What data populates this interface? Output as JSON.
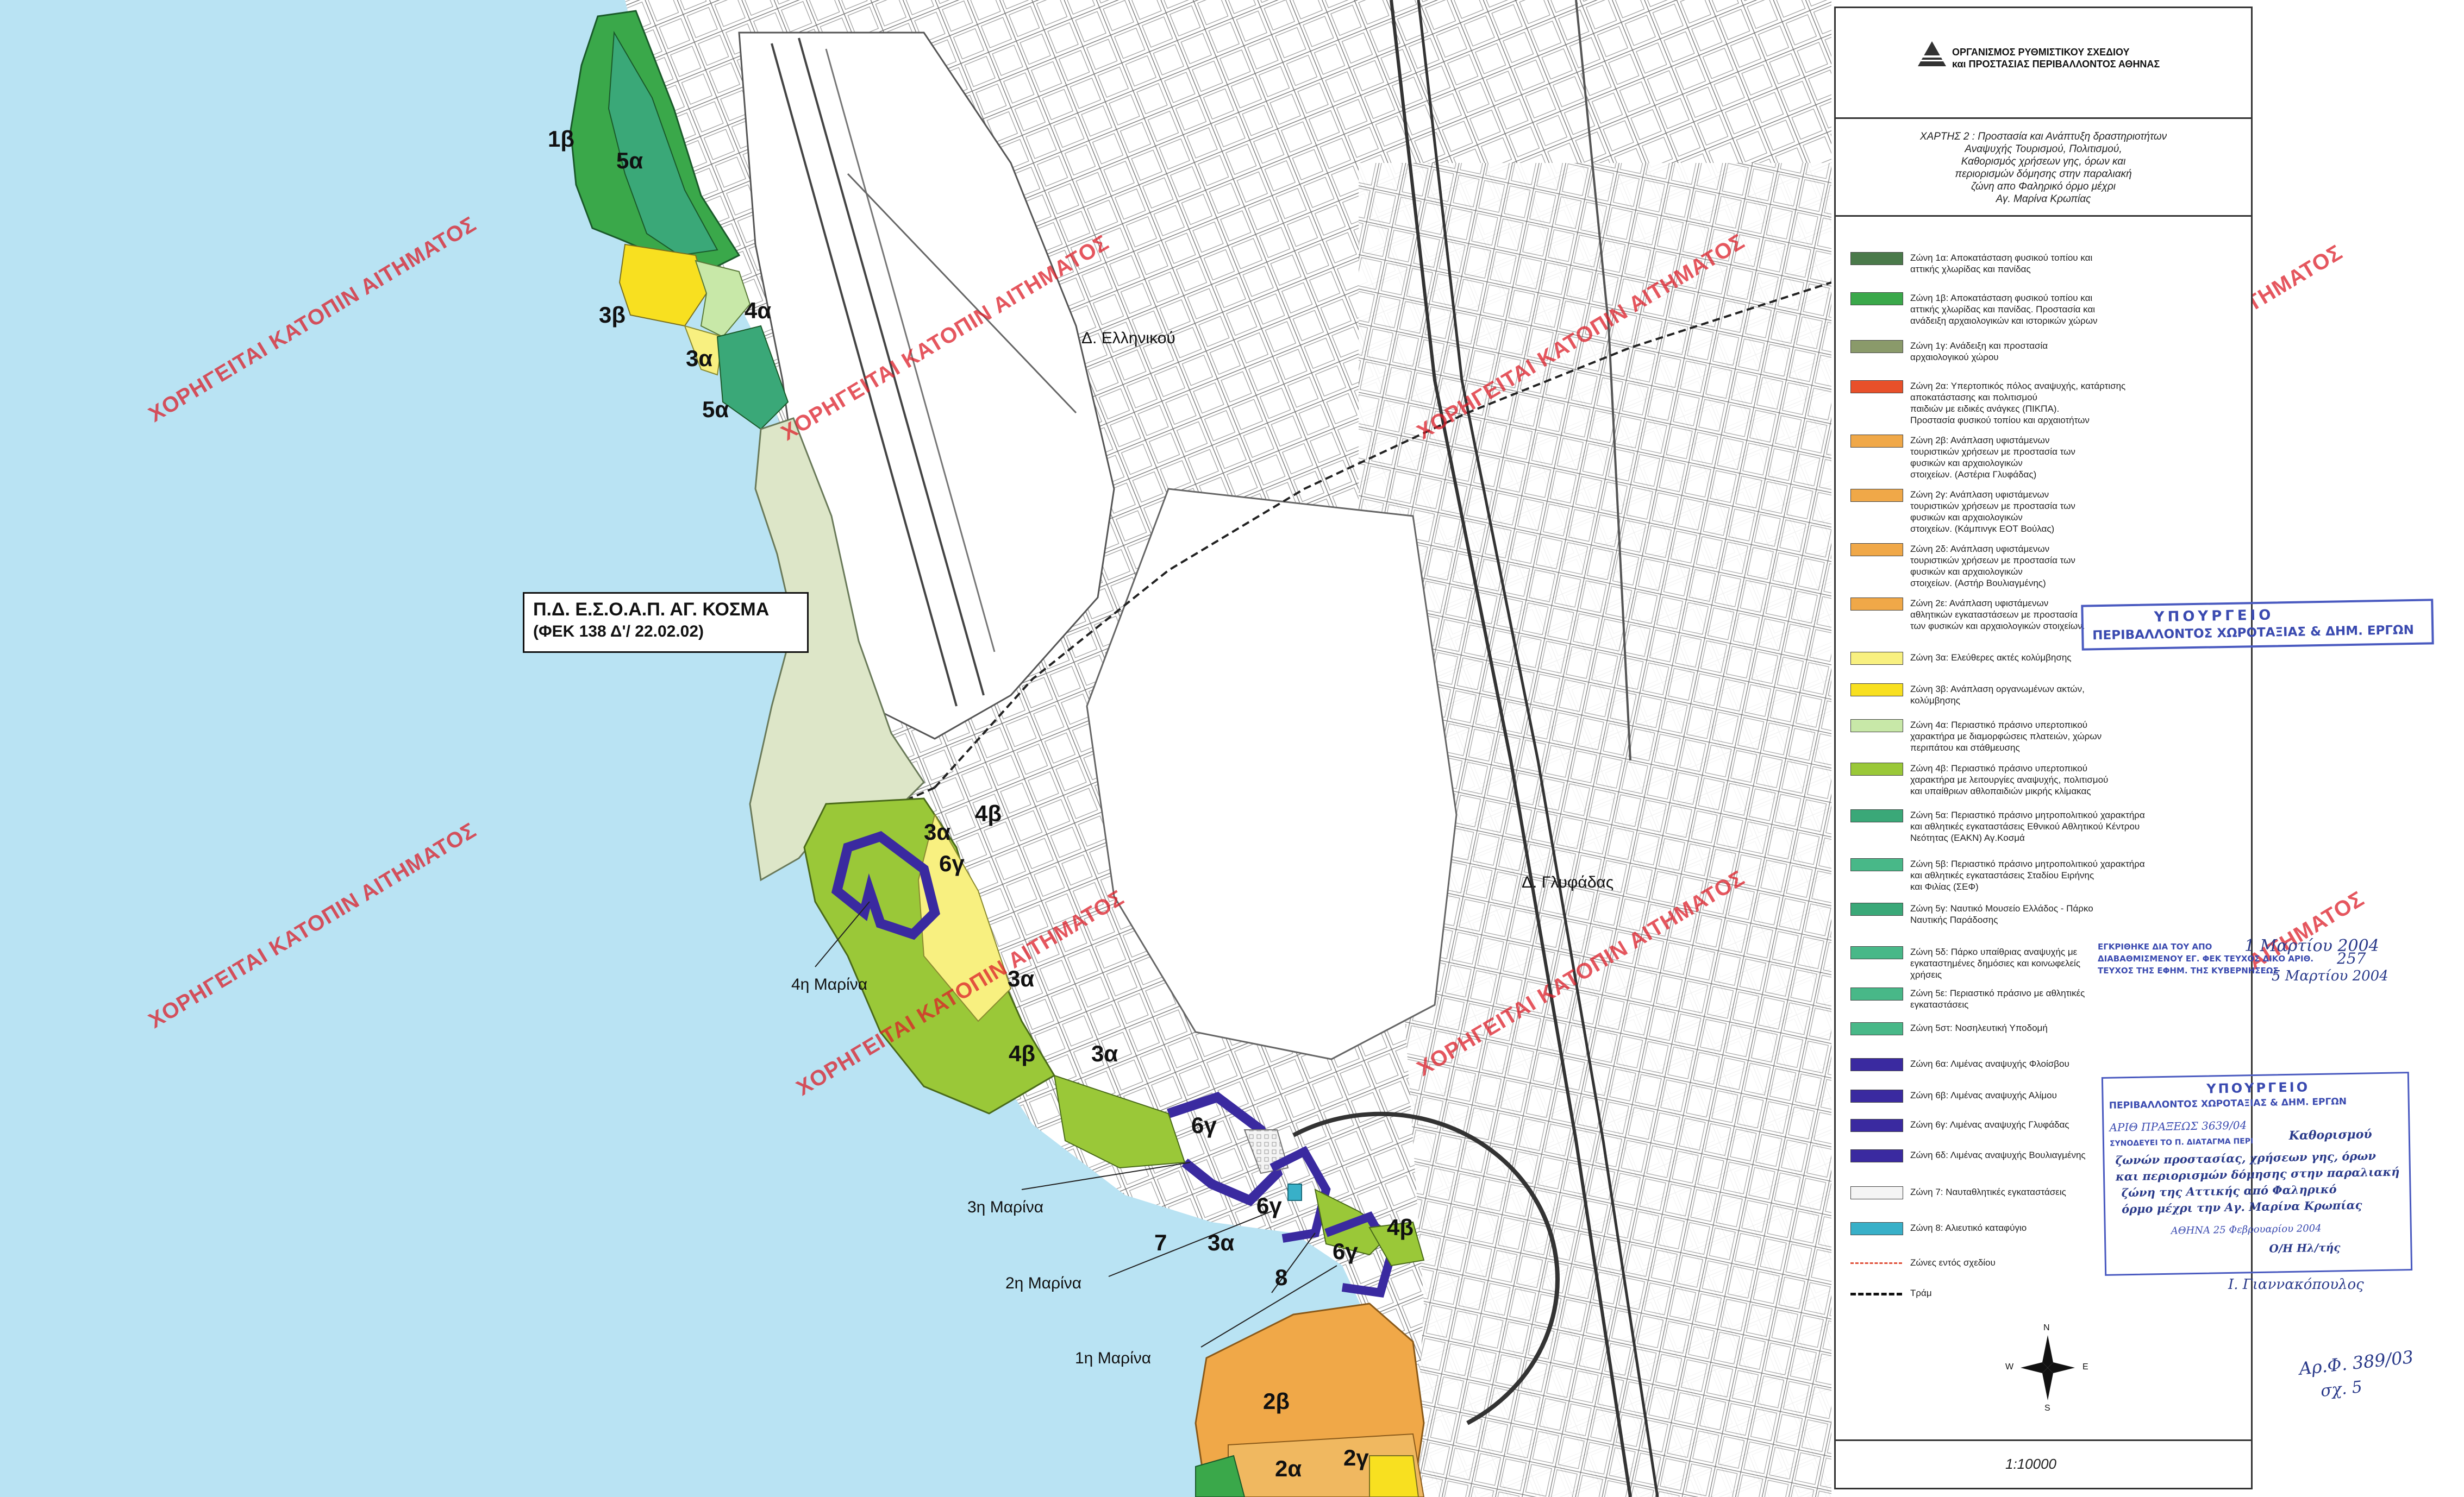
{
  "org": {
    "line1": "ΟΡΓΑΝΙΣΜΟΣ ΡΥΘΜΙΣΤΙΚΟΥ ΣΧΕΔΙΟΥ",
    "line2": "και ΠΡΟΣΤΑΣΙΑΣ ΠΕΡΙΒΑΛΛΟΝΤΟΣ ΑΘΗΝΑΣ"
  },
  "map_title": [
    "ΧΑΡΤΗΣ 2 : Προστασία και Ανάπτυξη δραστηριοτήτων",
    "Αναψυχής Τουρισμού, Πολιτισμού,",
    "Καθορισμός χρήσεων γης, όρων και",
    "περιορισμών δόμησης στην παραλιακή",
    "ζώνη απο Φαληρικό όρμο μέχρι",
    "Αγ. Μαρίνα Κρωπίας"
  ],
  "legend": [
    {
      "color": "#4a7a4a",
      "lines": [
        "Ζώνη 1α: Αποκατάσταση φυσικού τοπίου και",
        "αττικής χλωρίδας και πανίδας"
      ]
    },
    {
      "color": "#3aa84a",
      "lines": [
        "Ζώνη 1β: Αποκατάσταση φυσικού τοπίου και",
        "αττικής χλωρίδας και πανίδας. Προστασία και",
        "ανάδειξη αρχαιολογικών και ιστορικών χώρων"
      ]
    },
    {
      "color": "#8a9a6a",
      "lines": [
        "Ζώνη 1γ: Ανάδειξη και προστασία",
        "αρχαιολογικού χώρου"
      ]
    },
    {
      "color": "#e8502a",
      "lines": [
        "Ζώνη 2α: Υπερτοπικός πόλος αναψυχής, κατάρτισης",
        "αποκατάστασης και πολιτισμού",
        "παιδιών με ειδικές ανάγκες (ΠΙΚΠΑ).",
        "Προστασία φυσικού τοπίου και αρχαιοτήτων"
      ]
    },
    {
      "color": "#f0a848",
      "lines": [
        "Ζώνη 2β: Ανάπλαση υφιστάμενων",
        "τουριστικών χρήσεων με προστασία των",
        "φυσικών και αρχαιολογικών",
        "στοιχείων. (Αστέρια Γλυφάδας)"
      ]
    },
    {
      "color": "#f0a848",
      "lines": [
        "Ζώνη 2γ: Ανάπλαση υφιστάμενων",
        "τουριστικών χρήσεων με προστασία των",
        "φυσικών και αρχαιολογικών",
        "στοιχείων. (Κάμπινγκ ΕΟΤ Βούλας)"
      ]
    },
    {
      "color": "#f0a848",
      "lines": [
        "Ζώνη 2δ: Ανάπλαση υφιστάμενων",
        "τουριστικών χρήσεων με προστασία των",
        "φυσικών και αρχαιολογικών",
        "στοιχείων. (Αστήρ Βουλιαγμένης)"
      ]
    },
    {
      "color": "#f0a848",
      "lines": [
        "Ζώνη 2ε: Ανάπλαση υφιστάμενων",
        "αθλητικών εγκαταστάσεων με προστασία",
        "των φυσικών και αρχαιολογικών στοιχείων."
      ]
    },
    {
      "color": "#f8f080",
      "lines": [
        "Ζώνη 3α: Ελεύθερες ακτές κολύμβησης"
      ]
    },
    {
      "color": "#f8e020",
      "lines": [
        "Ζώνη 3β: Ανάπλαση οργανωμένων ακτών,",
        "κολύμβησης"
      ]
    },
    {
      "color": "#c8e8a8",
      "lines": [
        "Ζώνη 4α: Περιαστικό πράσινο υπερτοπικού",
        "χαρακτήρα με διαμορφώσεις πλατειών, χώρων",
        "περιπάτου και στάθμευσης"
      ]
    },
    {
      "color": "#9ac838",
      "lines": [
        "Ζώνη 4β: Περιαστικό πράσινο υπερτοπικού",
        "χαρακτήρα με λειτουργίες αναψυχής, πολιτισμού",
        "και υπαίθριων αθλοπαιδιών μικρής κλίμακας"
      ]
    },
    {
      "color": "#3aa878",
      "lines": [
        "Ζώνη 5α: Περιαστικό πράσινο μητροπολιτικού χαρακτήρα",
        "και αθλητικές εγκαταστάσεις Εθνικού Αθλητικού Κέντρου",
        "Νεότητας (ΕΑΚΝ) Αγ.Κοσμά"
      ]
    },
    {
      "color": "#48b888",
      "lines": [
        "Ζώνη 5β: Περιαστικό πράσινο μητροπολιτικού χαρακτήρα",
        "και αθλητικές εγκαταστάσεις Σταδίου Ειρήνης",
        "και Φιλίας (ΣΕΦ)"
      ]
    },
    {
      "color": "#3aa878",
      "lines": [
        "Ζώνη 5γ: Ναυτικό Μουσείο Ελλάδος - Πάρκο",
        "Ναυτικής Παράδοσης"
      ]
    },
    {
      "color": "#48b888",
      "lines": [
        "Ζώνη 5δ: Πάρκο υπαίθριας αναψυχής με",
        "εγκαταστημένες δημόσιες και κοινωφελείς",
        "χρήσεις"
      ]
    },
    {
      "color": "#48b888",
      "lines": [
        "Ζώνη 5ε: Περιαστικό πράσινο με αθλητικές",
        "εγκαταστάσεις"
      ]
    },
    {
      "color": "#48b888",
      "lines": [
        "Ζώνη 5στ: Νοσηλευτική Υποδομή"
      ]
    },
    {
      "color": "#3a2aa0",
      "lines": [
        "Ζώνη 6α: Λιμένας αναψυχής Φλοίσβου"
      ]
    },
    {
      "color": "#3a2aa0",
      "lines": [
        "Ζώνη 6β: Λιμένας αναψυχής Αλίμου"
      ]
    },
    {
      "color": "#3a2aa0",
      "lines": [
        "Ζώνη 6γ: Λιμένας αναψυχής Γλυφάδας"
      ]
    },
    {
      "color": "#3a2aa0",
      "lines": [
        "Ζώνη 6δ: Λιμένας αναψυχής Βουλιαγμένης"
      ]
    },
    {
      "color": "#f4f4f4",
      "lines": [
        "Ζώνη 7: Ναυταθλητικές εγκαταστάσεις"
      ]
    },
    {
      "color": "#38b0c8",
      "lines": [
        "Ζώνη 8: Αλιευτικό καταφύγιο"
      ]
    },
    {
      "color": "line-dash",
      "lines": [
        "Ζώνες εντός σχεδίου"
      ]
    },
    {
      "color": "line-tram",
      "lines": [
        "Τράμ"
      ]
    }
  ],
  "compass": {
    "n": "N",
    "s": "S",
    "e": "E",
    "w": "W"
  },
  "scale": "1:10000",
  "map_labels": {
    "zones": [
      {
        "t": "1β"
      },
      {
        "t": "5α"
      },
      {
        "t": "3β"
      },
      {
        "t": "4α"
      },
      {
        "t": "3α"
      },
      {
        "t": "5α"
      },
      {
        "t": "3α"
      },
      {
        "t": "4β"
      },
      {
        "t": "6γ"
      },
      {
        "t": "3α"
      },
      {
        "t": "4β"
      },
      {
        "t": "3α"
      },
      {
        "t": "6γ"
      },
      {
        "t": "6γ"
      },
      {
        "t": "3α"
      },
      {
        "t": "7"
      },
      {
        "t": "8"
      },
      {
        "t": "6γ"
      },
      {
        "t": "4β"
      },
      {
        "t": "2β"
      },
      {
        "t": "2α"
      },
      {
        "t": "2γ"
      }
    ],
    "places": {
      "ellinikou": "Δ. Ελληνικού",
      "glyfadas": "Δ. Γλυφάδας"
    },
    "marinas": {
      "m4": "4η Μαρίνα",
      "m3": "3η Μαρίνα",
      "m2": "2η Μαρίνα",
      "m1": "1η Μαρίνα"
    },
    "pd_box": {
      "line1": "Π.Δ.  Ε.Σ.Ο.Α.Π.  ΑΓ. ΚΟΣΜΑ",
      "line2": "(ΦΕΚ 138 Δ'/ 22.02.02)"
    }
  },
  "watermark": "ΧΟΡΗΓΕΙΤΑΙ ΚΑΤΟΠΙΝ ΑΙΤΗΜΑΤΟΣ",
  "stamps": {
    "ministry_1": "ΥΠΟΥΡΓΕΙΟ",
    "ministry_2": "ΠΕΡΙΒΑΛΛΟΝΤΟΣ ΧΩΡΟΤΑΞΙΑΣ & ΔΗΜ. ΕΡΓΩΝ",
    "approval_1": "ΕΓΚΡΙΘΗΚΕ ΔΙΑ ΤΟΥ ΑΠΟ",
    "approval_date": "1 Μαρτίου 2004",
    "approval_fek": "257",
    "approval_2": "ΔΙΑΒΑΘΜΙΣΜΕΝΟΥ ΕΓ. ΦΕΚ ΤΕΥΧΟΣ ΔΙΚΟ ΑΡΙΘ.",
    "approval_3": "ΤΕΥΧΟΣ ΤΗΣ ΕΦΗΜ. ΤΗΣ ΚΥΒΕΡΝΗΣΕΩΣ",
    "approval_4": "5 Μαρτίου 2004",
    "ref_no": "ΑΡΙΘ ΠΡΑΞΕΩΣ 3639/04",
    "accompanies": "ΣΥΝΟΔΕΥΕΙ ΤΟ Π. ΔΙΑΤΑΓΜΑ ΠΕΡΙ",
    "hand_1": "Καθορισμού",
    "hand_2": "ζωνών προστασίας, χρήσεων γης, όρων",
    "hand_3": "και περιορισμών δόμησης στην παραλιακή",
    "hand_4": "ζώνη της Αττικής από Φαληρικό",
    "hand_5": "όρμο μέχρι την Αγ. Μαρίνα Κρωπίας",
    "athens": "ΑΘΗΝΑ 25 Φεβρουαρίου 2004",
    "signer_role": "Ο/Η Ηλ/τής",
    "signer": "Ι. Γιαννακόπουλος"
  },
  "margin_notes": {
    "ar": "Αρ.Φ. 389/03",
    "sx": "σχ. 5"
  }
}
